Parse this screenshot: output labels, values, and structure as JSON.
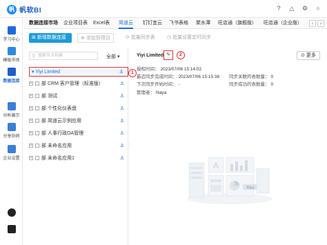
{
  "app": {
    "logo_mark": "帆",
    "logo_text": "帆软BI"
  },
  "top_icons": [
    "help-icon",
    "bell-icon",
    "settings-icon",
    "avatar-icon"
  ],
  "sidebar": {
    "items": [
      {
        "label": "学习中心",
        "icon": "book-icon"
      },
      {
        "label": "模板市场",
        "icon": "template-icon"
      },
      {
        "label": "数据连接",
        "icon": "database-icon"
      },
      {
        "label": "分析展示",
        "icon": "chart-icon"
      },
      {
        "label": "分享协同",
        "icon": "share-icon"
      },
      {
        "label": "企业设置",
        "icon": "enterprise-icon"
      }
    ],
    "bottom": [
      "help-circle-icon",
      "document-icon"
    ]
  },
  "tabs": [
    "数据连接市场",
    "企业项目表",
    "Excel表",
    "简道云",
    "钉钉宜云",
    "飞书表格",
    "聚水潭",
    "旺店通（旗舰版）",
    "旺店通（企业版）"
  ],
  "active_tab": 3,
  "toolbar": {
    "new_conn": "新增数据连接",
    "add_project": "添加到项目",
    "batch_sync": "批量同步表",
    "batch_sync_setting": "批量设置定时同步"
  },
  "tree": {
    "search_placeholder": "搜索节点和表",
    "filter": "全部",
    "root": "Yiyi Limited",
    "children": [
      "CRM 客户管理（标准版）",
      "测试",
      "个性化仪表盘",
      "简道云示例应用",
      "人事行政OA管理",
      "未命名应用",
      "未命名应用1"
    ],
    "child_prefix": "部",
    "badge1": "1"
  },
  "detail": {
    "title": "Yiyi Limited",
    "badge2": "2",
    "more": "更多",
    "fields": {
      "auth_time_label": "授权时间：",
      "auth_time": "2023/07/06 15:14:02",
      "last_sync_label": "最近同步完成时间：",
      "last_sync": "2023/07/06 15:15:38",
      "synced_tables_label": "同步关联的表数量：",
      "synced_tables": "0",
      "next_sync_label": "下次同步开始时间：",
      "next_sync": "-",
      "success_tables_label": "同步成功的表数量：",
      "success_tables": "0",
      "admin_label": "管理者：",
      "admin": "Naya"
    },
    "illustration_label": "简道云"
  }
}
